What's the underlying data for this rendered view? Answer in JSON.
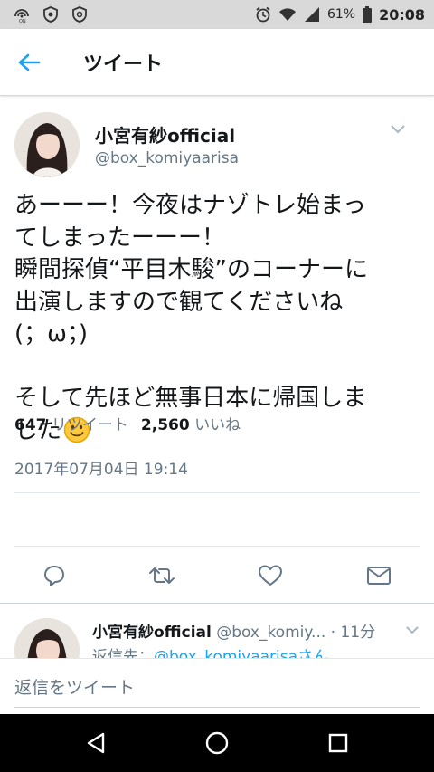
{
  "status_bar": {
    "battery": "61%",
    "time": "20:08",
    "icons": [
      "signal-on-icon",
      "shield-icon",
      "shield-icon",
      "alarm-icon",
      "wifi-icon",
      "cell-signal-icon",
      "battery-icon"
    ]
  },
  "app_bar": {
    "title": "ツイート",
    "back_icon": "back-arrow-icon"
  },
  "tweet": {
    "author_name": "小宮有紗official",
    "author_handle": "@box_komiyaarisa",
    "lines": [
      "あーーー！今夜はナゾトレ始まっ",
      "てしまったーーー！",
      "瞬間探偵“平目木駿”のコーナーに",
      "出演しますので観てくださいね",
      "(；ω；)",
      "",
      "そして先ほど無事日本に帰国しま",
      "した"
    ],
    "timestamp": "2017年07月04日 19:14",
    "retweets_count": "647",
    "retweets_label": "リツイート",
    "likes_count": "2,560",
    "likes_label": "いいね"
  },
  "actions": [
    "reply-icon",
    "retweet-icon",
    "like-icon",
    "direct-message-icon"
  ],
  "reply": {
    "author_name": "小宮有紗official",
    "author_handle": "@box_komiy...",
    "time": "· 11分",
    "reply_to_label": "返信先：",
    "reply_to_mention": "@box_komiyaarisaさん"
  },
  "compose": {
    "placeholder": "返信をツイート"
  },
  "colors": {
    "accent": "#1da1f2",
    "text": "#14171a",
    "secondary": "#657786",
    "status_bar": "#d9d9d9",
    "smiley": "#ffc83d"
  }
}
